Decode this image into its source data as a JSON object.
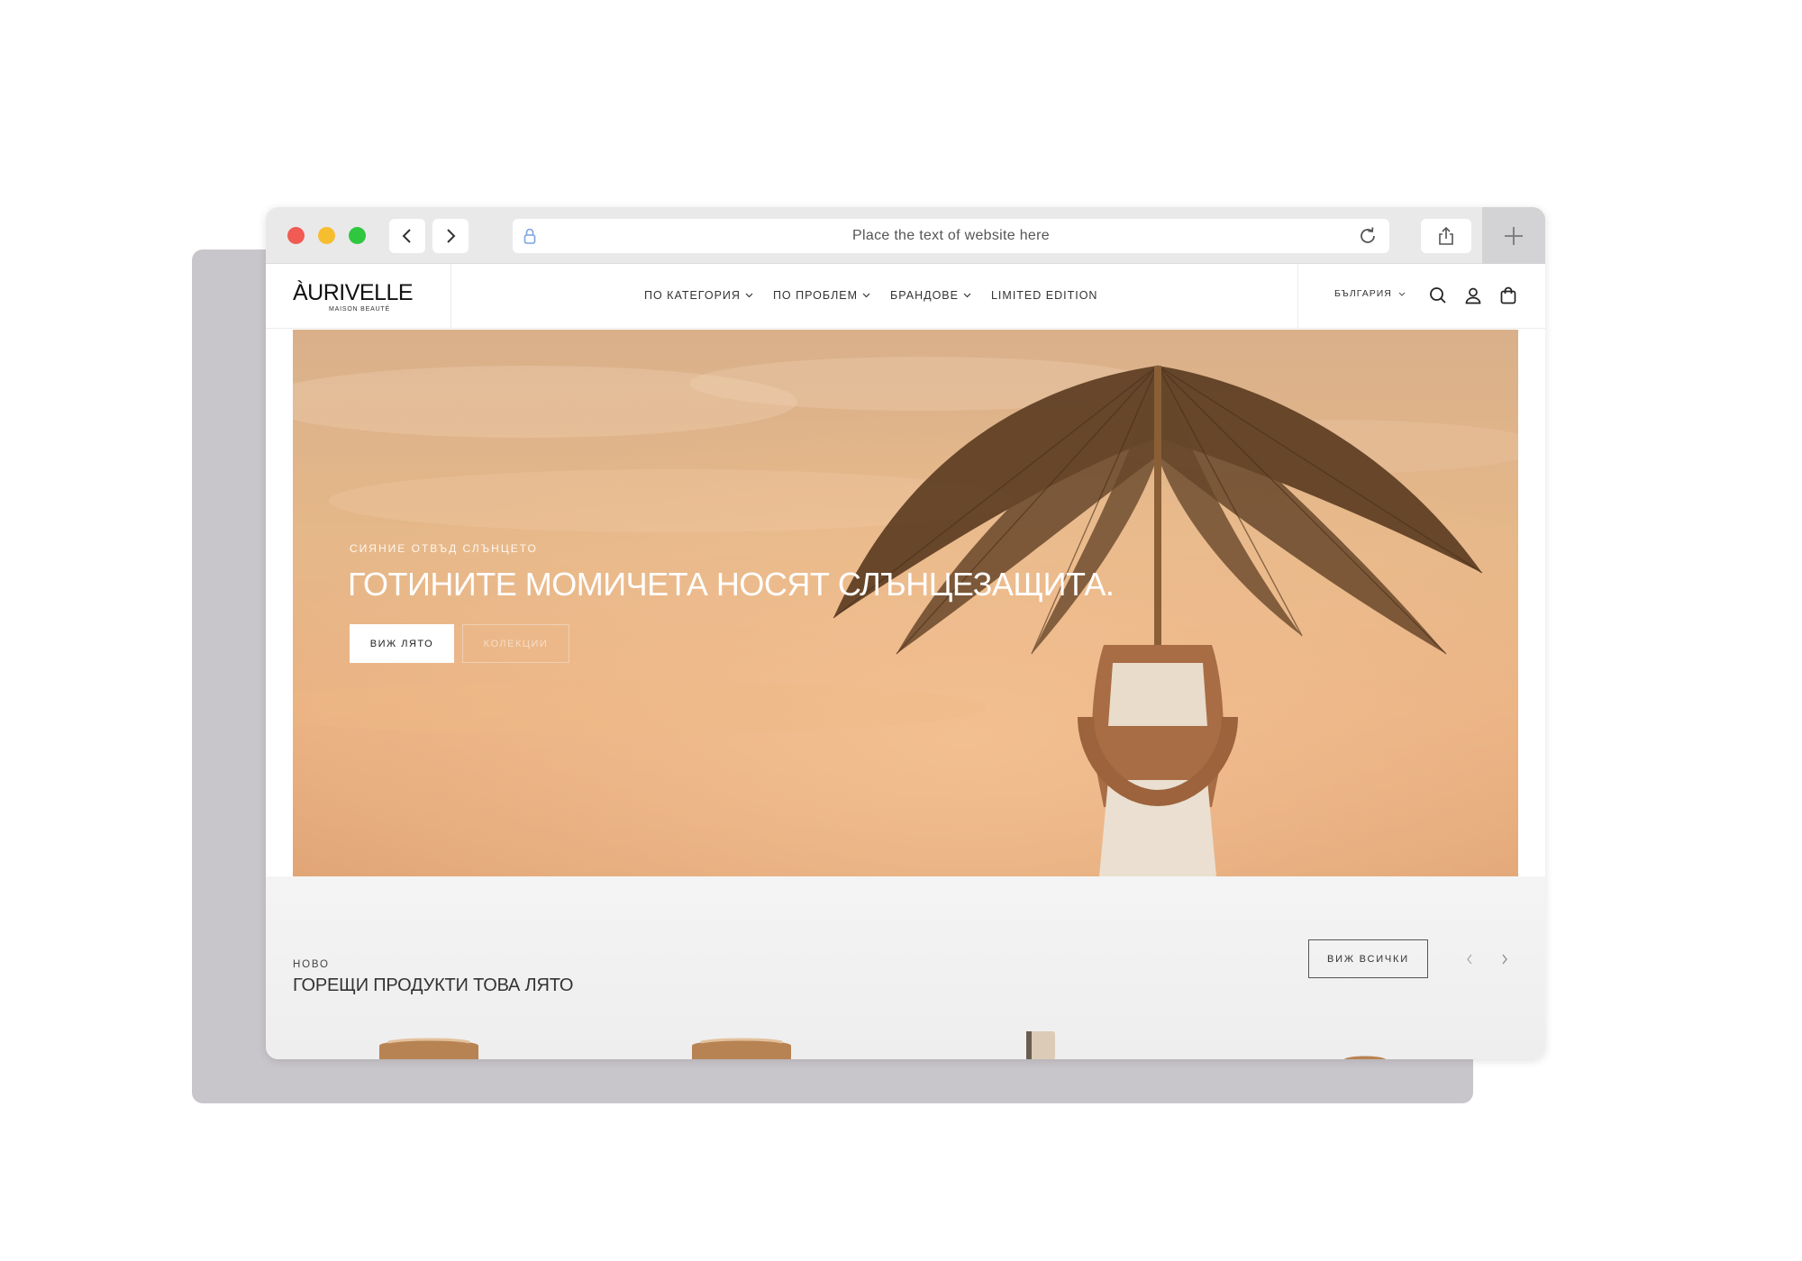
{
  "browser": {
    "address": "Place the text of website here"
  },
  "site": {
    "logo": "ÀURIVELLE",
    "logo_sub": "MAISON BEAUTÉ",
    "nav": [
      {
        "label": "ПО КАТЕГОРИЯ",
        "has_dropdown": true
      },
      {
        "label": "ПО ПРОБЛЕМ",
        "has_dropdown": true
      },
      {
        "label": "БРАНДОВЕ",
        "has_dropdown": true
      },
      {
        "label": "LIMITED EDITION",
        "has_dropdown": false
      }
    ],
    "country": "БЪЛГАРИЯ",
    "icons": [
      "search-icon",
      "user-icon",
      "bag-icon"
    ]
  },
  "hero": {
    "eyebrow": "СИЯНИЕ ОТВЪД СЛЪНЦЕТО",
    "title": "ГОТИНИТЕ МОМИЧЕТА НОСЯТ СЛЪНЦЕЗАЩИТА.",
    "primary_button": "ВИЖ ЛЯТО",
    "secondary_button": "КОЛЕКЦИИ"
  },
  "new_section": {
    "eyebrow": "НОВО",
    "title": "ГОРЕЩИ ПРОДУКТИ ТОВА ЛЯТО",
    "view_all": "ВИЖ ВСИЧКИ"
  },
  "colors": {
    "hero_sky": "#e6b889",
    "close": "#f05b54",
    "minimize": "#f6bd2f",
    "maximize": "#2fc740"
  }
}
